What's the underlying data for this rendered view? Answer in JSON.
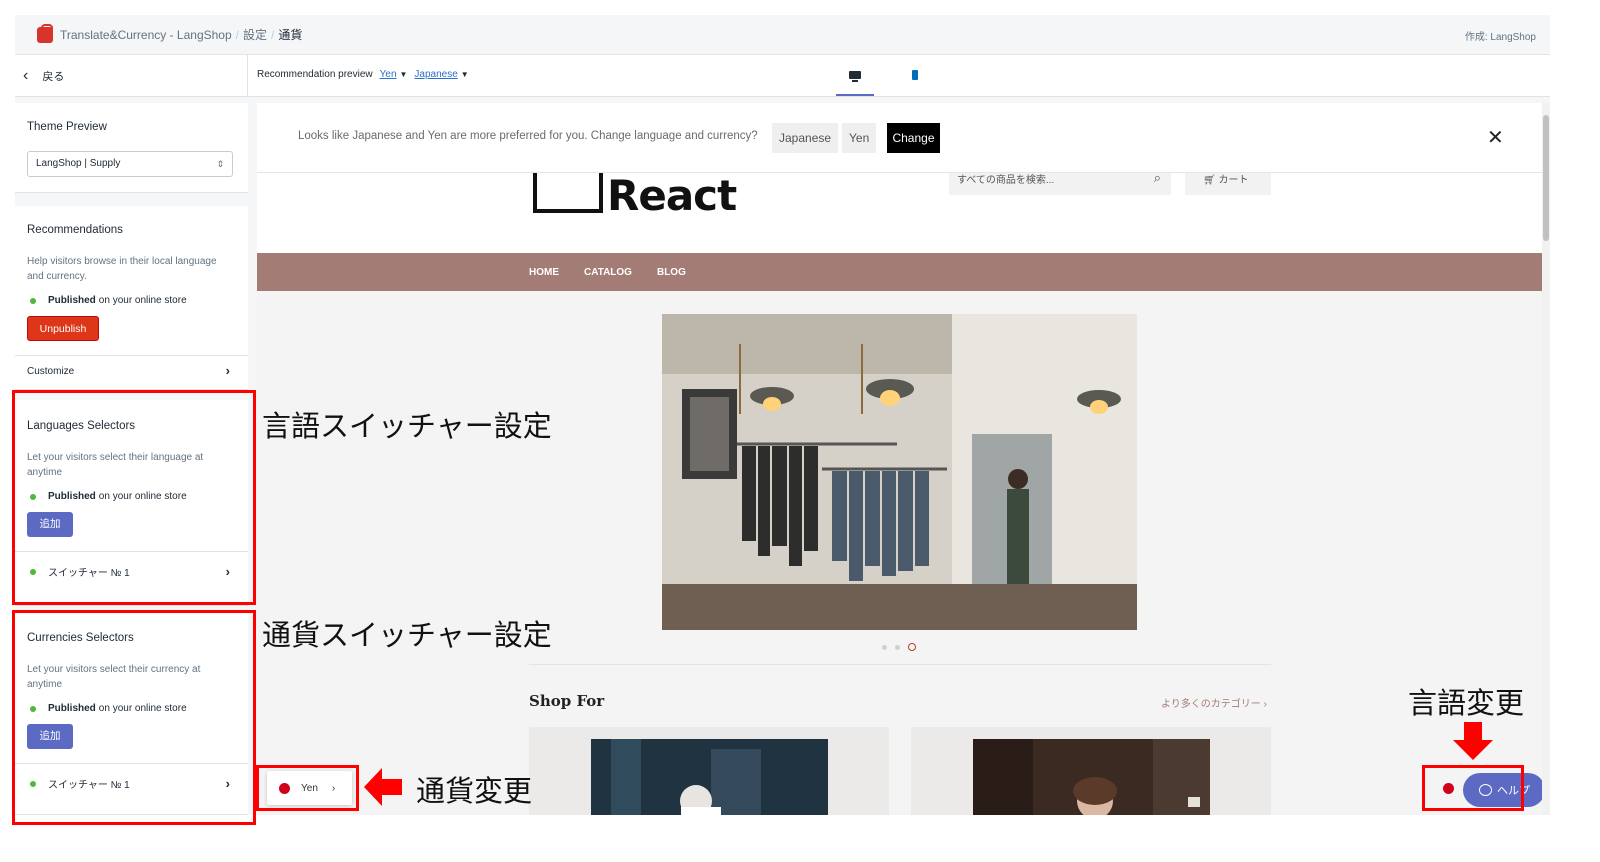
{
  "topbar": {
    "app_name": "Translate&Currency - LangShop",
    "crumb_settings": "設定",
    "crumb_current": "通貨",
    "author": "作成: LangShop"
  },
  "subbar": {
    "back_label": "戻る",
    "preview_label": "Recommendation preview",
    "currency_value": "Yen",
    "language_value": "Japanese",
    "device_icons": [
      "desktop-icon",
      "mobile-icon"
    ]
  },
  "sidebar": {
    "theme_preview": {
      "title": "Theme Preview",
      "select_value": "LangShop | Supply"
    },
    "recommendations": {
      "title": "Recommendations",
      "desc": "Help visitors browse in their local language and currency.",
      "status_bold": "Published",
      "status_rest": "on your online store",
      "button": "Unpublish"
    },
    "customize": {
      "label": "Customize"
    },
    "languages": {
      "title": "Languages Selectors",
      "desc": "Let your visitors select their language at anytime",
      "status_bold": "Published",
      "status_rest": "on your online store",
      "button": "追加",
      "item": "スイッチャー № 1"
    },
    "currencies": {
      "title": "Currencies Selectors",
      "desc": "Let your visitors select their currency at anytime",
      "status_bold": "Published",
      "status_rest": "on your online store",
      "button": "追加",
      "item": "スイッチャー № 1"
    }
  },
  "preview": {
    "banner": {
      "message": "Looks like Japanese and Yen are more preferred for you. Change language and currency?",
      "language": "Japanese",
      "currency": "Yen",
      "change": "Change"
    },
    "store": {
      "logo": "React",
      "search_placeholder": "すべての商品を検索...",
      "cart": "カート",
      "nav": [
        "HOME",
        "CATALOG",
        "BLOG"
      ],
      "section_title": "Shop For",
      "more_categories": "より多くのカテゴリー ›"
    },
    "currency_switcher": "Yen",
    "help_button": "ヘルプ"
  },
  "annotations": {
    "language_settings": "言語スイッチャー設定",
    "currency_settings": "通貨スイッチャー設定",
    "currency_change": "通貨変更",
    "language_change": "言語変更"
  },
  "colors": {
    "annotation_red": "#ff0000",
    "nav_brown": "#a47c76",
    "unpublish_red": "#de3618",
    "primary_indigo": "#5c6ac4"
  }
}
